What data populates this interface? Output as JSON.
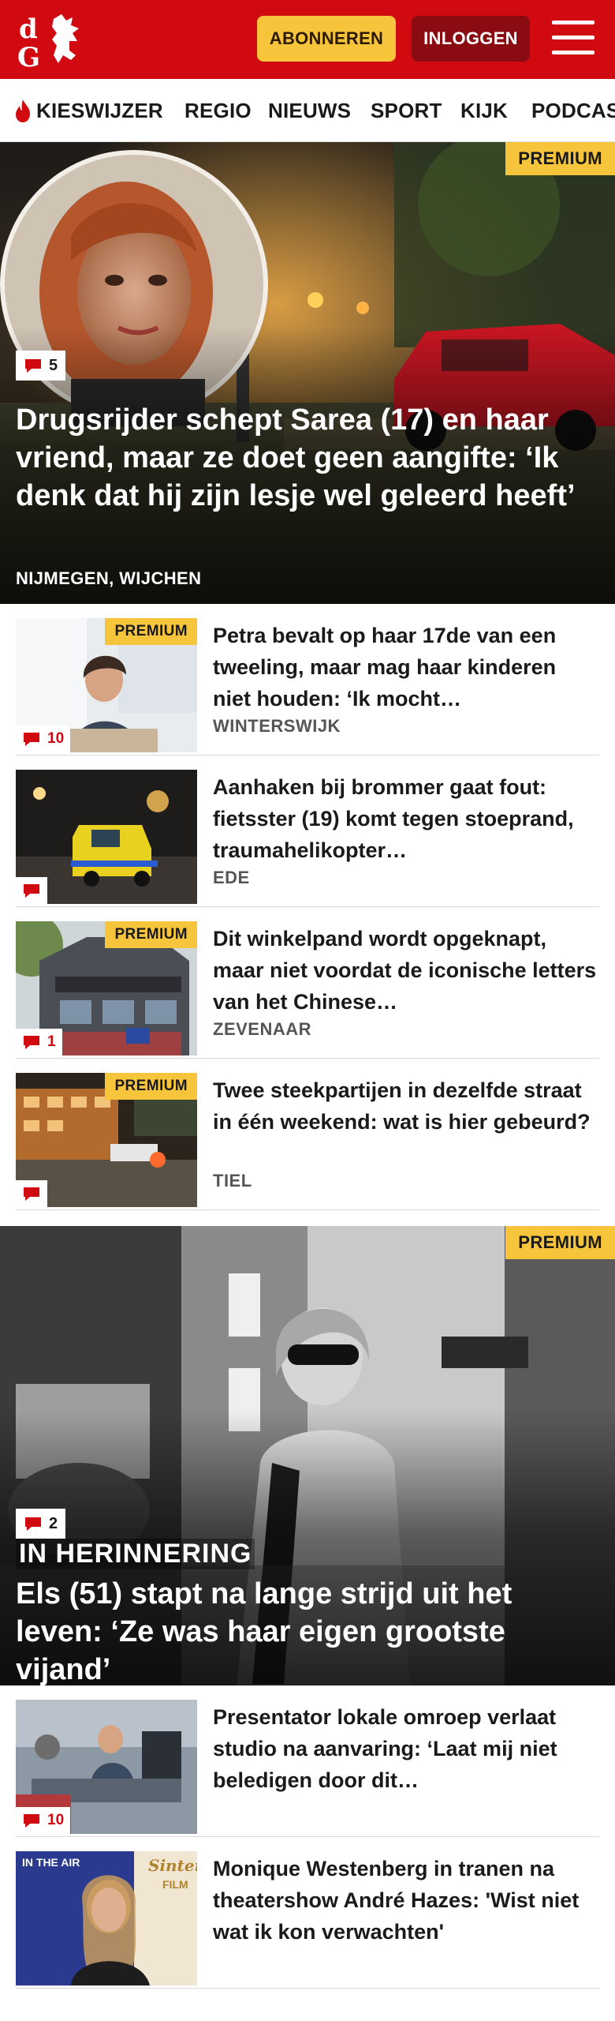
{
  "header": {
    "logo_text": "dG",
    "subscribe_label": "ABONNEREN",
    "login_label": "INLOGGEN",
    "brand_color": "#d10a11"
  },
  "nav": {
    "items": [
      {
        "label": "KIESWIJZER",
        "icon": "flame-icon"
      },
      {
        "label": "REGIO"
      },
      {
        "label": "NIEUWS"
      },
      {
        "label": "SPORT"
      },
      {
        "label": "KIJK"
      },
      {
        "label": "PODCAS"
      }
    ]
  },
  "hero1": {
    "premium": "PREMIUM",
    "comments": "5",
    "title": "Drugsrijder schept Sarea (17) en haar vriend, maar ze doet geen aangifte: ‘Ik denk dat hij zijn lesje wel geleerd heeft’",
    "location": "NIJMEGEN, WIJCHEN"
  },
  "list1": [
    {
      "premium": "PREMIUM",
      "comments": "10",
      "title": "Petra bevalt op haar 17de van een tweeling, maar mag haar kinderen niet houden: ‘Ik mocht…",
      "location": "WINTERSWIJK"
    },
    {
      "premium": "",
      "comments": "",
      "title": "Aanhaken bij brommer gaat fout: fietsster (19) komt tegen stoeprand, traumahelikopter…",
      "location": "EDE"
    },
    {
      "premium": "PREMIUM",
      "comments": "1",
      "title": "Dit winkelpand wordt opgeknapt, maar niet voordat de iconische letters van het Chinese…",
      "location": "ZEVENAAR"
    },
    {
      "premium": "PREMIUM",
      "comments": "",
      "title": "Twee steekpartijen in dezelfde straat in één weekend: wat is hier gebeurd?",
      "location": "TIEL"
    }
  ],
  "hero2": {
    "premium": "PREMIUM",
    "comments": "2",
    "kicker": "IN HERINNERING",
    "title": "Els (51) stapt na lange strijd uit het leven: ‘Ze was haar eigen grootste vijand’"
  },
  "list2": [
    {
      "premium": "",
      "comments": "10",
      "title": "Presentator lokale omroep verlaat studio na aanvaring: ‘Laat mij niet beledigen door dit…",
      "location": ""
    },
    {
      "premium": "",
      "comments": "",
      "title": "Monique Westenberg in tranen na theatershow André Hazes: 'Wist niet wat ik kon verwachten'",
      "location": "",
      "thumb_text_1": "IN THE AIR",
      "thumb_text_2": "Sinterk",
      "thumb_text_3": "FILM"
    }
  ]
}
